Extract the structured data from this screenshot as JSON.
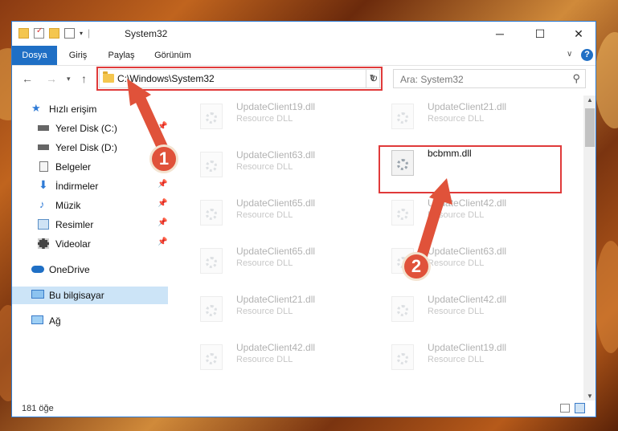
{
  "window": {
    "title": "System32"
  },
  "ribbon": {
    "tabs": [
      "Dosya",
      "Giriş",
      "Paylaş",
      "Görünüm"
    ]
  },
  "address": {
    "path": "C:\\Windows\\System32"
  },
  "search": {
    "placeholder": "Ara: System32"
  },
  "sidebar": {
    "items": [
      {
        "label": "Hızlı erişim",
        "icon": "star-icon"
      },
      {
        "label": "Yerel Disk (C:)",
        "icon": "drive-icon",
        "pinned": true
      },
      {
        "label": "Yerel Disk (D:)",
        "icon": "drive-icon"
      },
      {
        "label": "Belgeler",
        "icon": "documents-icon",
        "pinned": true
      },
      {
        "label": "İndirmeler",
        "icon": "download-icon",
        "pinned": true
      },
      {
        "label": "Müzik",
        "icon": "music-icon",
        "pinned": true
      },
      {
        "label": "Resimler",
        "icon": "pictures-icon",
        "pinned": true
      },
      {
        "label": "Videolar",
        "icon": "videos-icon",
        "pinned": true
      },
      {
        "label": "OneDrive",
        "icon": "cloud-icon"
      },
      {
        "label": "Bu bilgisayar",
        "icon": "computer-icon",
        "selected": true
      },
      {
        "label": "Ağ",
        "icon": "network-icon"
      }
    ]
  },
  "files": {
    "type_label": "Resource DLL",
    "left": [
      "UpdateClient19.dll",
      "UpdateClient63.dll",
      "UpdateClient65.dll",
      "UpdateClient65.dll",
      "UpdateClient21.dll",
      "UpdateClient42.dll"
    ],
    "right": [
      "UpdateClient21.dll",
      "bcbmm.dll",
      "UpdateClient42.dll",
      "UpdateClient63.dll",
      "UpdateClient42.dll",
      "UpdateClient19.dll"
    ],
    "highlighted": "bcbmm.dll"
  },
  "status": {
    "count": "181 öğe"
  },
  "annotations": {
    "step1": "1",
    "step2": "2"
  },
  "colors": {
    "accent": "#1f6fc5",
    "highlight": "#e03a3a",
    "annotation": "#e0523a"
  }
}
